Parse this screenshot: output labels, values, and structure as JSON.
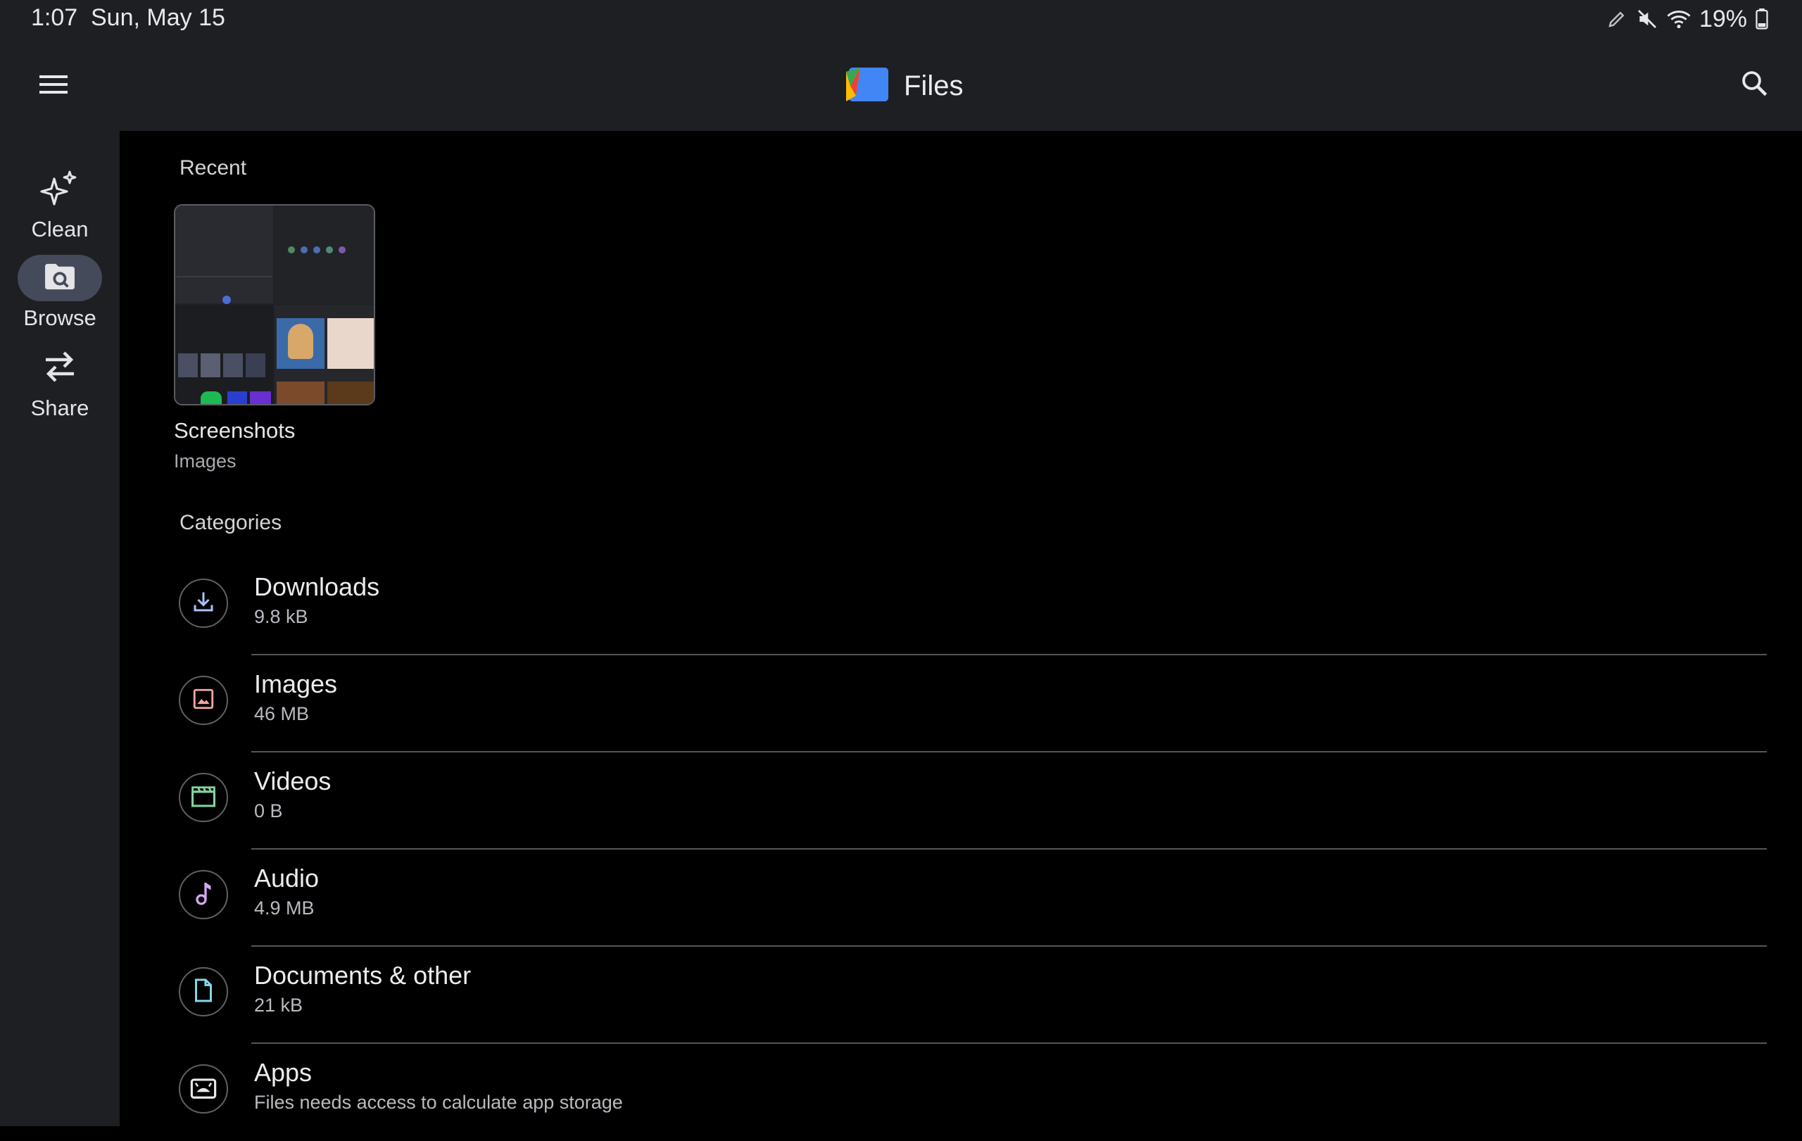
{
  "status_bar": {
    "time": "1:07",
    "date": "Sun, May 15",
    "battery": "19%",
    "icons": [
      "pen-icon",
      "mute-icon",
      "wifi-icon",
      "battery-icon"
    ]
  },
  "app_bar": {
    "title": "Files",
    "menu_icon": "menu-icon",
    "search_icon": "search-icon",
    "logo_colors": [
      "#4285f4",
      "#34a853",
      "#fbbc04",
      "#ea4335"
    ]
  },
  "nav_rail": {
    "items": [
      {
        "label": "Clean",
        "icon": "sparkle-icon",
        "active": false
      },
      {
        "label": "Browse",
        "icon": "folder-search-icon",
        "active": true
      },
      {
        "label": "Share",
        "icon": "swap-icon",
        "active": false
      }
    ]
  },
  "recent": {
    "heading": "Recent",
    "items": [
      {
        "name": "Screenshots",
        "type": "Images"
      }
    ]
  },
  "categories": {
    "heading": "Categories",
    "items": [
      {
        "name": "Downloads",
        "detail": "9.8 kB",
        "icon": "download-icon",
        "color": "#a9c3f7"
      },
      {
        "name": "Images",
        "detail": "46 MB",
        "icon": "image-icon",
        "color": "#f2a7a0"
      },
      {
        "name": "Videos",
        "detail": "0 B",
        "icon": "clapperboard-icon",
        "color": "#86d39d"
      },
      {
        "name": "Audio",
        "detail": "4.9 MB",
        "icon": "music-note-icon",
        "color": "#d7a9f2"
      },
      {
        "name": "Documents & other",
        "detail": "21 kB",
        "icon": "document-icon",
        "color": "#86d6e8"
      },
      {
        "name": "Apps",
        "detail": "Files needs access to calculate app storage",
        "icon": "android-apps-icon",
        "color": "#e8e8ec"
      }
    ]
  }
}
